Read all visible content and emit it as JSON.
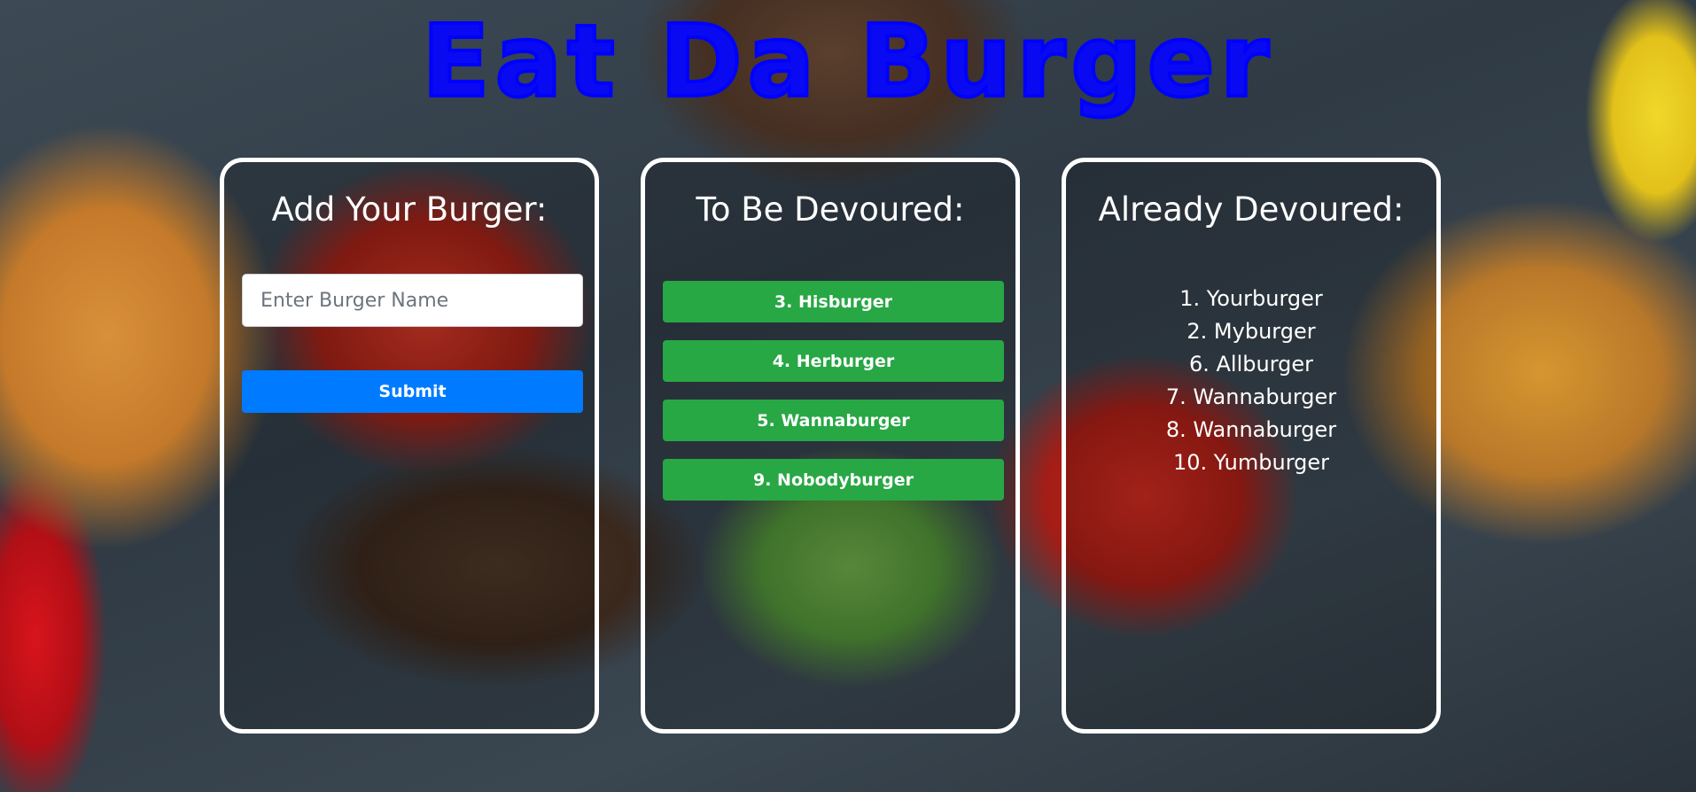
{
  "app": {
    "title": "Eat Da Burger"
  },
  "add_panel": {
    "heading": "Add Your Burger:",
    "input_placeholder": "Enter Burger Name",
    "input_value": "",
    "submit_label": "Submit"
  },
  "todo_panel": {
    "heading": "To Be Devoured:",
    "items": [
      {
        "label": "3. Hisburger"
      },
      {
        "label": "4. Herburger"
      },
      {
        "label": "5. Wannaburger"
      },
      {
        "label": "9. Nobodyburger"
      }
    ]
  },
  "done_panel": {
    "heading": "Already Devoured:",
    "items": [
      {
        "label": "1. Yourburger"
      },
      {
        "label": "2. Myburger"
      },
      {
        "label": "6. Allburger"
      },
      {
        "label": "7. Wannaburger"
      },
      {
        "label": "8. Wannaburger"
      },
      {
        "label": "10. Yumburger"
      }
    ]
  },
  "colors": {
    "title": "#0000ff",
    "submit_button": "#007bff",
    "devour_button": "#28a745",
    "panel_border": "#ffffff"
  }
}
